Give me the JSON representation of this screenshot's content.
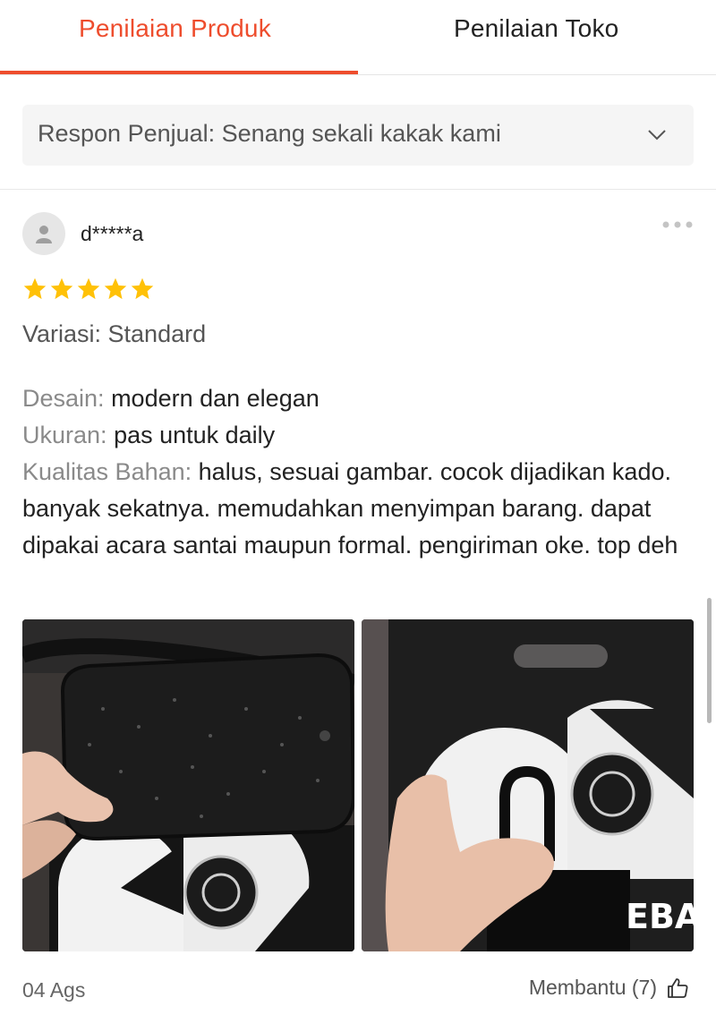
{
  "tabs": {
    "product": "Penilaian Produk",
    "shop": "Penilaian Toko"
  },
  "seller_response": {
    "label": "Respon Penjual:",
    "text": "Senang sekali kakak kami"
  },
  "review": {
    "username": "d*****a",
    "rating": 5,
    "variant": "Variasi: Standard",
    "design_label": "Desain:",
    "design_value": "modern dan elegan",
    "size_label": "Ukuran:",
    "size_value": "pas untuk daily",
    "quality_label": "Kualitas Bahan:",
    "quality_value": "halus, sesuai gambar. cocok dijadikan kado. banyak sekatnya. memudahkan menyimpan barang. dapat dipakai acara santai maupun formal. pengiriman oke. top deh",
    "date": "04 Ags",
    "helpful": "Membantu (7)"
  },
  "photos": {
    "photo2_text": "EBA"
  },
  "colors": {
    "accent": "#ee4d2d",
    "star": "#ffc107",
    "box_bg": "#f5f5f5"
  },
  "icons": [
    "user-avatar-icon",
    "more-dots-icon",
    "chevron-down-icon",
    "star-icon",
    "thumbs-up-icon"
  ]
}
